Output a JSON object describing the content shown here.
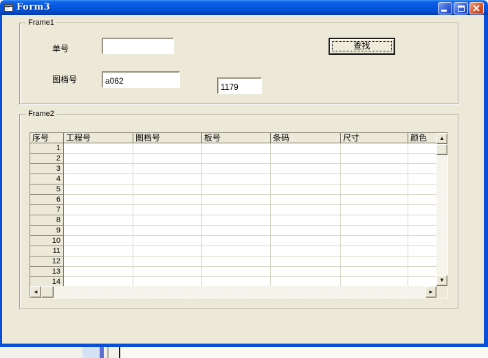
{
  "window": {
    "title": "Form3",
    "buttons": {
      "minimize": "minimize-icon",
      "maximize": "maximize-icon",
      "close": "close-icon"
    }
  },
  "frame1": {
    "label": "Frame1",
    "fields": {
      "order_label": "单号",
      "order_value": "",
      "drawing_label": "图档号",
      "drawing_value": "a062",
      "extra_value": "1179"
    },
    "search_button": "查找"
  },
  "frame2": {
    "label": "Frame2",
    "grid": {
      "columns": [
        "序号",
        "工程号",
        "图档号",
        "板号",
        "条码",
        "尺寸",
        "颜色"
      ],
      "rows": [
        "1",
        "2",
        "3",
        "4",
        "5",
        "6",
        "7",
        "8",
        "9",
        "10",
        "11",
        "12",
        "13",
        "14"
      ]
    }
  },
  "icons": {
    "scroll_up": "▲",
    "scroll_down": "▼",
    "scroll_left": "◄",
    "scroll_right": "►"
  }
}
